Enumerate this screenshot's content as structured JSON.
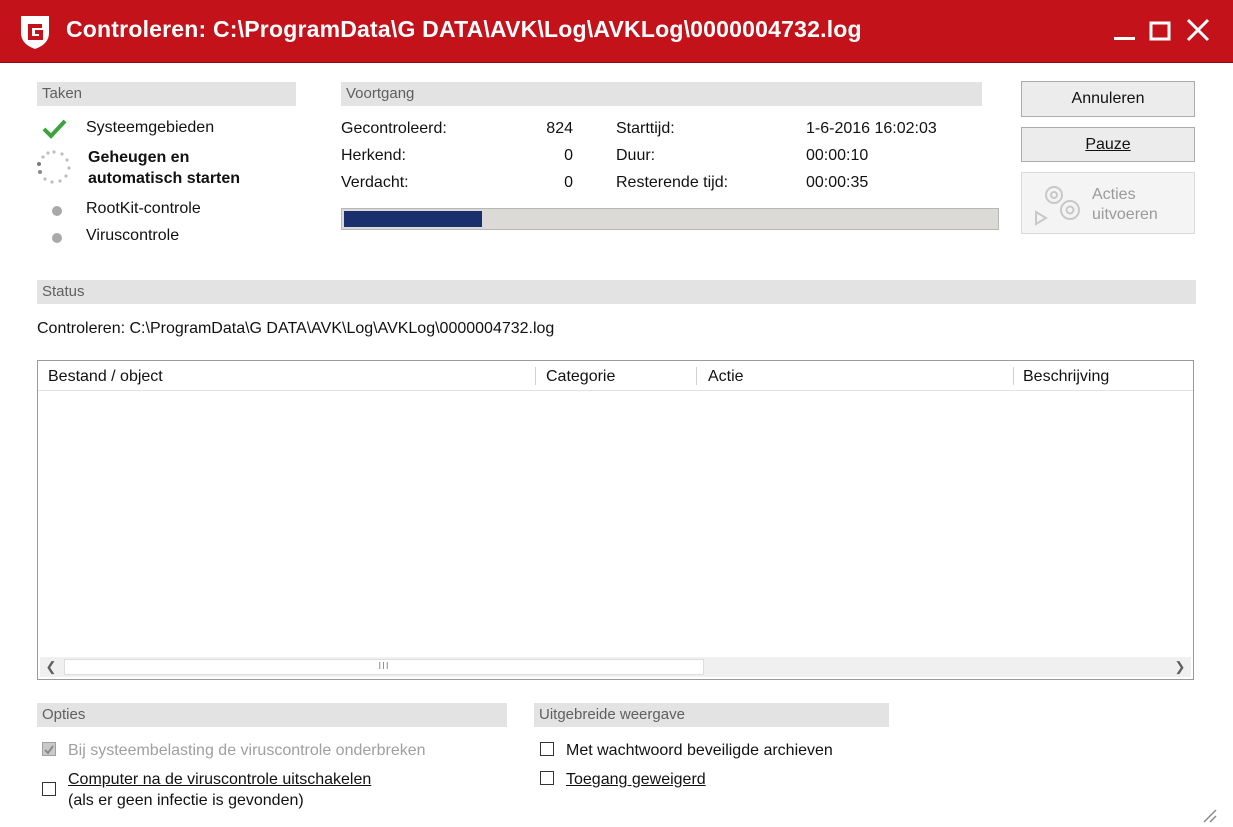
{
  "window": {
    "title": "Controleren: C:\\ProgramData\\G DATA\\AVK\\Log\\AVKLog\\0000004732.log",
    "accent": "#c4121a",
    "logo_icon": "g-data-shield-icon"
  },
  "tasks": {
    "header": "Taken",
    "items": [
      {
        "label": "Systeemgebieden",
        "state": "done",
        "icon": "checkmark-icon"
      },
      {
        "label": "Geheugen en automatisch starten",
        "line1": "Geheugen en",
        "line2": "automatisch starten",
        "state": "running",
        "icon": "spinner-icon"
      },
      {
        "label": "RootKit-controle",
        "state": "pending",
        "icon": "grey-dot-icon"
      },
      {
        "label": "Viruscontrole",
        "state": "pending",
        "icon": "grey-dot-icon"
      }
    ]
  },
  "progress": {
    "header": "Voortgang",
    "gecontroleerd_label": "Gecontroleerd:",
    "gecontroleerd_value": "824",
    "herkend_label": "Herkend:",
    "herkend_value": "0",
    "verdacht_label": "Verdacht:",
    "verdacht_value": "0",
    "starttijd_label": "Starttijd:",
    "starttijd_value": "1-6-2016 16:02:03",
    "duur_label": "Duur:",
    "duur_value": "00:00:10",
    "resterend_label": "Resterende tijd:",
    "resterend_value": "00:00:35",
    "bar_fraction": 0.21,
    "bar_color": "#1a2f6e"
  },
  "buttons": {
    "annuleren": "Annuleren",
    "pauze": "Pauze",
    "acties_line1": "Acties",
    "acties_line2": "uitvoeren"
  },
  "status": {
    "header": "Status",
    "text": "Controleren: C:\\ProgramData\\G DATA\\AVK\\Log\\AVKLog\\0000004732.log"
  },
  "table": {
    "columns": [
      "Bestand / object",
      "Categorie",
      "Actie",
      "Beschrijving"
    ],
    "rows": [],
    "scroll_thumb_glyph": "III"
  },
  "options": {
    "header": "Opties",
    "items": [
      {
        "label": "Bij systeembelasting de viruscontrole onderbreken",
        "checked": true,
        "enabled": false
      },
      {
        "label": "Computer na de viruscontrole uitschakelen",
        "line2": "(als er geen infectie is gevonden)",
        "checked": false,
        "enabled": true
      }
    ]
  },
  "extended": {
    "header": "Uitgebreide weergave",
    "items": [
      {
        "label": "Met wachtwoord beveiligde archieven",
        "checked": false
      },
      {
        "label": "Toegang geweigerd",
        "checked": false
      }
    ]
  }
}
